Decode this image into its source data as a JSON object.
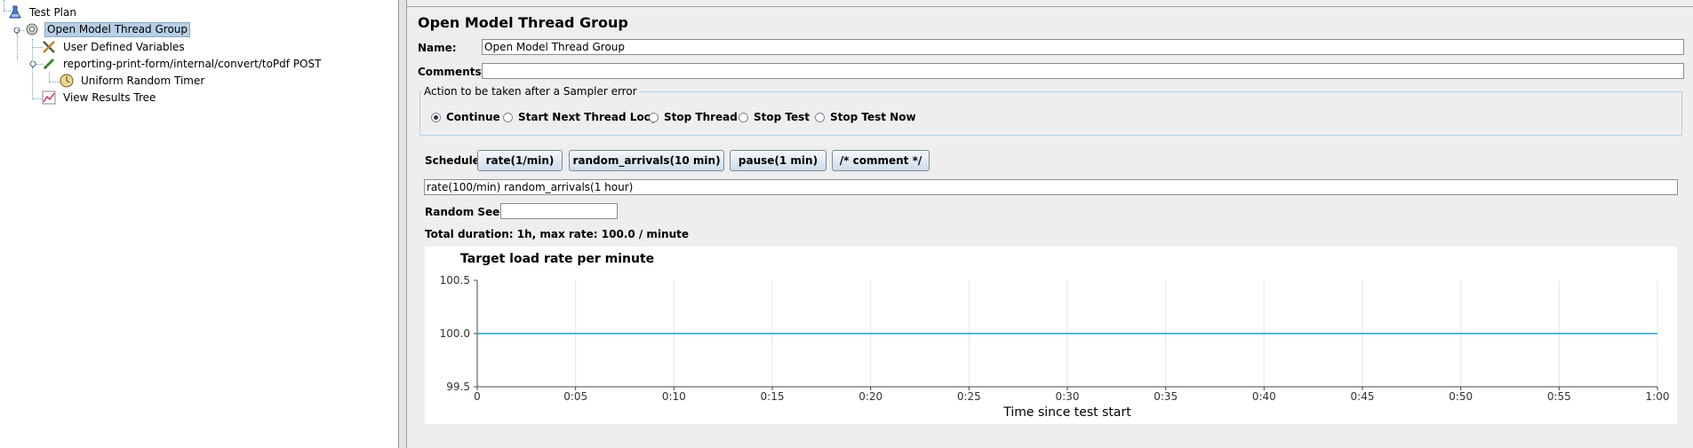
{
  "tree": {
    "test_plan": "Test Plan",
    "thread_group": "Open Model Thread Group",
    "user_vars": "User Defined Variables",
    "sampler": "reporting-print-form/internal/convert/toPdf POST",
    "timer": "Uniform Random Timer",
    "results": "View Results Tree"
  },
  "panel": {
    "title": "Open Model Thread Group",
    "name_label": "Name:",
    "name_value": "Open Model Thread Group",
    "comments_label": "Comments:",
    "comments_value": "",
    "error_group_label": "Action to be taken after a Sampler error",
    "error_options": [
      {
        "label": "Continue",
        "selected": true
      },
      {
        "label": "Start Next Thread Loop",
        "selected": false
      },
      {
        "label": "Stop Thread",
        "selected": false
      },
      {
        "label": "Stop Test",
        "selected": false
      },
      {
        "label": "Stop Test Now",
        "selected": false
      }
    ],
    "schedule_label": "Schedule",
    "schedule_buttons": [
      "rate(1/min)",
      "random_arrivals(10 min)",
      "pause(1 min)",
      "/* comment */"
    ],
    "schedule_value": "rate(100/min) random_arrivals(1 hour)",
    "seed_label": "Random Seed",
    "seed_value": "",
    "summary": "Total duration: 1h, max rate: 100.0 / minute"
  },
  "chart_data": {
    "type": "line",
    "title": "Target load rate per minute",
    "xlabel": "Time since test start",
    "ylabel": "",
    "x_ticks": [
      "0",
      "0:05",
      "0:10",
      "0:15",
      "0:20",
      "0:25",
      "0:30",
      "0:35",
      "0:40",
      "0:45",
      "0:50",
      "0:55",
      "1:00"
    ],
    "y_ticks": [
      "99.5",
      "100.0",
      "100.5"
    ],
    "ylim": [
      99.5,
      100.5
    ],
    "xlim_minutes": [
      0,
      60
    ],
    "series": [
      {
        "x": [
          0,
          60
        ],
        "y": [
          100.0,
          100.0
        ],
        "color": "#1f9bde"
      }
    ],
    "grid": true
  }
}
